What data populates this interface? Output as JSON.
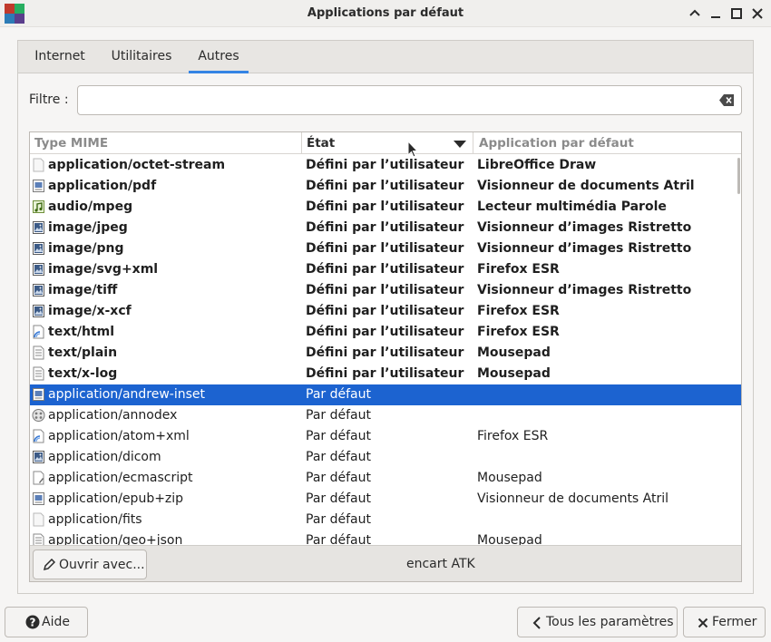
{
  "window": {
    "title": "Applications par défaut"
  },
  "tabs": [
    {
      "label": "Internet",
      "active": false
    },
    {
      "label": "Utilitaires",
      "active": false
    },
    {
      "label": "Autres",
      "active": true
    }
  ],
  "filter": {
    "label": "Filtre :",
    "value": "",
    "placeholder": ""
  },
  "table": {
    "columns": [
      "Type MIME",
      "État",
      "Application par défaut"
    ],
    "sorted_column": "État",
    "rows": [
      {
        "mime": "application/octet-stream",
        "state": "Défini par l’utilisateur",
        "app": "LibreOffice Draw",
        "icon": "blank-file-icon",
        "bold": true
      },
      {
        "mime": "application/pdf",
        "state": "Défini par l’utilisateur",
        "app": "Visionneur de documents Atril",
        "icon": "document-file-icon",
        "bold": true
      },
      {
        "mime": "audio/mpeg",
        "state": "Défini par l’utilisateur",
        "app": "Lecteur multimédia Parole",
        "icon": "audio-file-icon",
        "bold": true
      },
      {
        "mime": "image/jpeg",
        "state": "Défini par l’utilisateur",
        "app": "Visionneur d’images Ristretto",
        "icon": "image-file-icon",
        "bold": true
      },
      {
        "mime": "image/png",
        "state": "Défini par l’utilisateur",
        "app": "Visionneur d’images Ristretto",
        "icon": "image-file-icon",
        "bold": true
      },
      {
        "mime": "image/svg+xml",
        "state": "Défini par l’utilisateur",
        "app": "Firefox ESR",
        "icon": "image-file-icon",
        "bold": true
      },
      {
        "mime": "image/tiff",
        "state": "Défini par l’utilisateur",
        "app": "Visionneur d’images Ristretto",
        "icon": "image-file-icon",
        "bold": true
      },
      {
        "mime": "image/x-xcf",
        "state": "Défini par l’utilisateur",
        "app": "Firefox ESR",
        "icon": "image-file-icon",
        "bold": true
      },
      {
        "mime": "text/html",
        "state": "Défini par l’utilisateur",
        "app": "Firefox ESR",
        "icon": "web-file-icon",
        "bold": true
      },
      {
        "mime": "text/plain",
        "state": "Défini par l’utilisateur",
        "app": "Mousepad",
        "icon": "text-file-icon",
        "bold": true
      },
      {
        "mime": "text/x-log",
        "state": "Défini par l’utilisateur",
        "app": "Mousepad",
        "icon": "text-file-icon",
        "bold": true
      },
      {
        "mime": "application/andrew-inset",
        "state": "Par défaut",
        "app": "",
        "icon": "document-file-icon",
        "bold": false,
        "selected": true
      },
      {
        "mime": "application/annodex",
        "state": "Par défaut",
        "app": "",
        "icon": "multimedia-file-icon",
        "bold": false
      },
      {
        "mime": "application/atom+xml",
        "state": "Par défaut",
        "app": "Firefox ESR",
        "icon": "web-file-icon",
        "bold": false
      },
      {
        "mime": "application/dicom",
        "state": "Par défaut",
        "app": "",
        "icon": "image-file-icon",
        "bold": false
      },
      {
        "mime": "application/ecmascript",
        "state": "Par défaut",
        "app": "Mousepad",
        "icon": "script-file-icon",
        "bold": false
      },
      {
        "mime": "application/epub+zip",
        "state": "Par défaut",
        "app": "Visionneur de documents Atril",
        "icon": "document-file-icon",
        "bold": false
      },
      {
        "mime": "application/fits",
        "state": "Par défaut",
        "app": "",
        "icon": "blank-file-icon",
        "bold": false
      },
      {
        "mime": "application/geo+json",
        "state": "Par défaut",
        "app": "Mousepad",
        "icon": "text-file-icon",
        "bold": false
      }
    ]
  },
  "footer": {
    "open_with_label": "Ouvrir avec...",
    "status_text": "encart ATK"
  },
  "buttons": {
    "help": "Aide",
    "all_settings": "Tous les paramètres",
    "close": "Fermer"
  },
  "colors": {
    "selection": "#1c63d0",
    "tab_underline": "#3584e4"
  }
}
